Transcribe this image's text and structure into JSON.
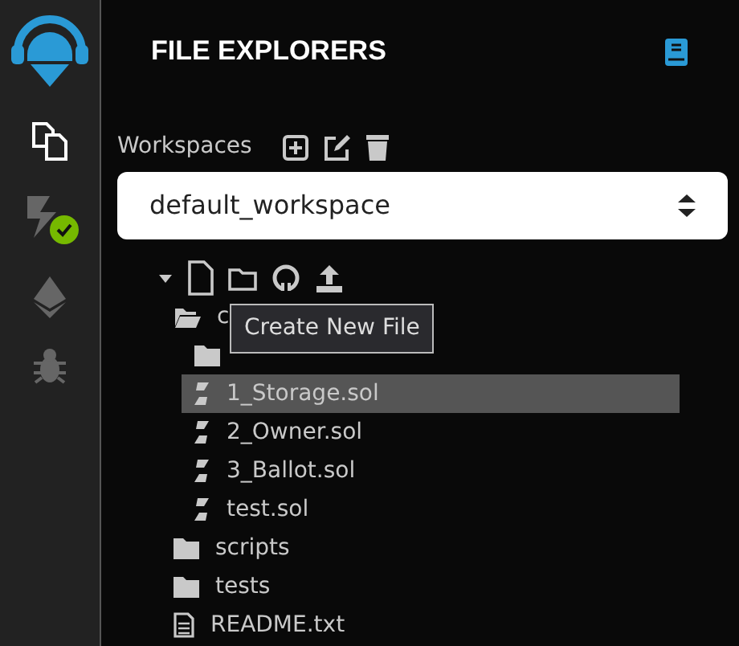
{
  "panel": {
    "title": "FILE EXPLORERS"
  },
  "workspaces": {
    "label": "Workspaces",
    "selected_workspace": "default_workspace"
  },
  "tree": {
    "expanded": true,
    "items": [
      {
        "kind": "folder",
        "name": "c",
        "expanded": true,
        "selected": false,
        "children": [
          {
            "kind": "folder",
            "expanded": false,
            "selected": false
          },
          {
            "kind": "sol",
            "name": "1_Storage.sol",
            "selected": true
          },
          {
            "kind": "sol",
            "name": "2_Owner.sol",
            "selected": false
          },
          {
            "kind": "sol",
            "name": "3_Ballot.sol",
            "selected": false
          },
          {
            "kind": "sol",
            "name": "test.sol",
            "selected": false
          }
        ]
      },
      {
        "kind": "folder",
        "name": "scripts",
        "expanded": false,
        "selected": false
      },
      {
        "kind": "folder",
        "name": "tests",
        "expanded": false,
        "selected": false
      },
      {
        "kind": "text",
        "name": "README.txt",
        "selected": false
      }
    ]
  },
  "tooltip": {
    "text": "Create New File"
  }
}
